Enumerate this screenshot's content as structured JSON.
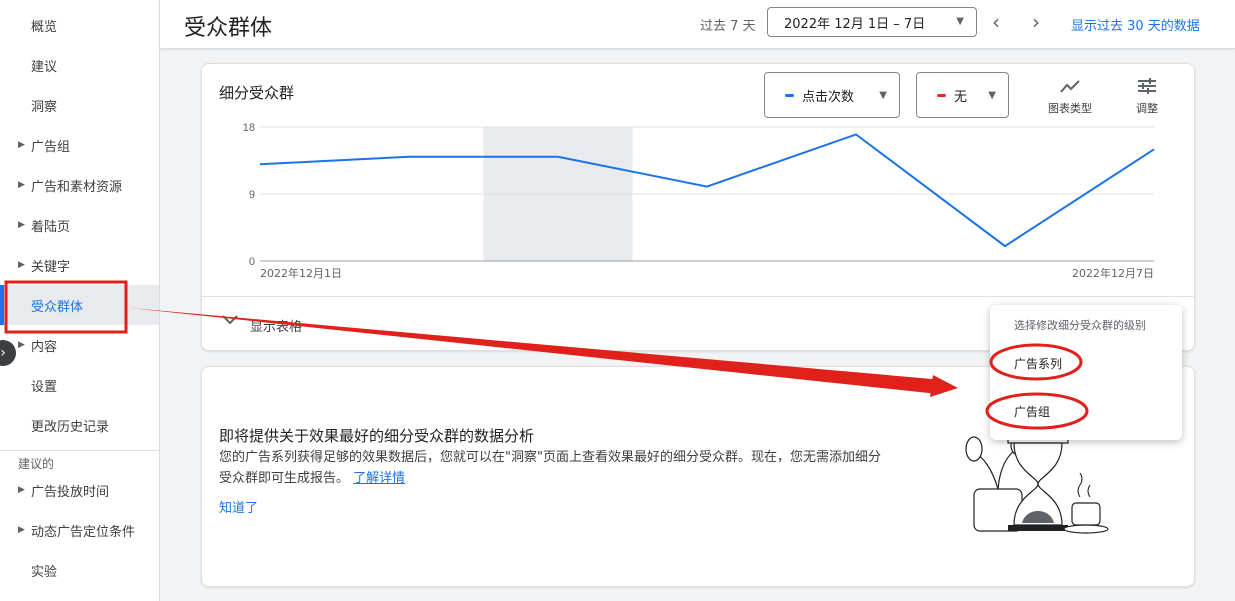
{
  "sidebar": {
    "items": [
      {
        "label": "概览",
        "caret": false
      },
      {
        "label": "建议",
        "caret": false
      },
      {
        "label": "洞察",
        "caret": false
      },
      {
        "label": "广告组",
        "caret": true
      },
      {
        "label": "广告和素材资源",
        "caret": true
      },
      {
        "label": "着陆页",
        "caret": true
      },
      {
        "label": "关键字",
        "caret": true
      },
      {
        "label": "受众群体",
        "caret": false,
        "active": true
      },
      {
        "label": "内容",
        "caret": true
      },
      {
        "label": "设置",
        "caret": false
      },
      {
        "label": "更改历史记录",
        "caret": false
      }
    ],
    "suggested_section": "建议的",
    "suggested_items": [
      {
        "label": "广告投放时间",
        "caret": true
      },
      {
        "label": "动态广告定位条件",
        "caret": true
      },
      {
        "label": "实验",
        "caret": false
      }
    ]
  },
  "header": {
    "title": "受众群体",
    "period_label": "过去 7 天",
    "date_range": "2022年 12月 1日 – 7日",
    "show_30_days": "显示过去 30 天的数据"
  },
  "chart_card": {
    "title": "细分受众群",
    "metric1": "点击次数",
    "metric2": "无",
    "chart_type_label": "图表类型",
    "adjust_label": "调整",
    "show_table": "显示表格"
  },
  "chart_data": {
    "type": "line",
    "x": [
      "2022-12-01",
      "2022-12-02",
      "2022-12-03",
      "2022-12-04",
      "2022-12-05",
      "2022-12-06",
      "2022-12-07"
    ],
    "series": [
      {
        "values": [
          13,
          14,
          14,
          10,
          17,
          2,
          15
        ]
      }
    ],
    "yticks": [
      "18",
      "9",
      "0"
    ],
    "ylim": [
      0,
      18
    ],
    "x_start_label": "2022年12月1日",
    "x_end_label": "2022年12月7日",
    "highlighted_x": "2022-12-03",
    "colors": {
      "metric1": "#1a73e8",
      "metric2": "#d93025"
    }
  },
  "insight_card": {
    "title": "即将提供关于效果最好的细分受众群的数据分析",
    "desc": "您的广告系列获得足够的效果数据后，您就可以在\"洞察\"页面上查看效果最好的细分受众群。现在，您无需添加细分受众群即可生成报告。",
    "learn_more": "了解详情",
    "got_it": "知道了"
  },
  "popup": {
    "header": "选择修改细分受众群的级别",
    "items": [
      "广告系列",
      "广告组"
    ]
  },
  "annotation_color": "#e0201b"
}
